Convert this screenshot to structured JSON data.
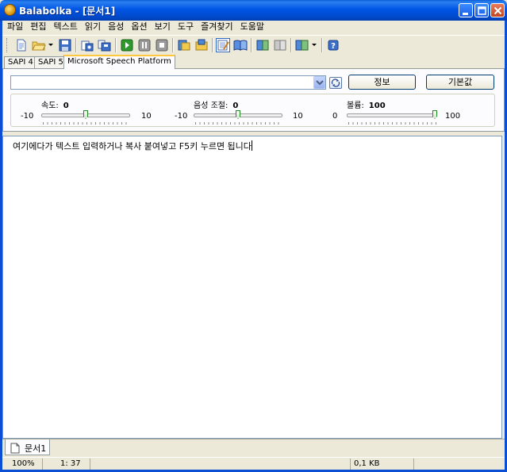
{
  "window": {
    "title": "Balabolka - [문서1]"
  },
  "menu": [
    "파일",
    "편집",
    "텍스트",
    "읽기",
    "음성",
    "옵션",
    "보기",
    "도구",
    "즐겨찾기",
    "도움말"
  ],
  "toolbar": {
    "icons": [
      "new-document-icon",
      "open-folder-icon",
      "save-icon",
      "export-audio-icon",
      "batch-convert-icon",
      "play-icon",
      "pause-icon",
      "stop-icon",
      "spell-check-icon",
      "dictionary-icon",
      "edit-mode-icon",
      "read-mode-icon",
      "voice-a-icon",
      "voice-b-icon",
      "voice-settings-icon",
      "help-icon"
    ]
  },
  "tabs": [
    "SAPI 4",
    "SAPI 5",
    "Microsoft Speech Platform"
  ],
  "voice": {
    "selected": "",
    "info_button": "정보",
    "default_button": "기본값"
  },
  "sliders": {
    "rate": {
      "label": "속도:",
      "value": "0",
      "min": "-10",
      "max": "10",
      "level": 0.5
    },
    "pitch": {
      "label": "음성 조절:",
      "value": "0",
      "min": "-10",
      "max": "10",
      "level": 0.5
    },
    "volume": {
      "label": "볼륨:",
      "value": "100",
      "min": "0",
      "max": "100",
      "level": 1.0
    }
  },
  "editor": {
    "text": "여기에다가 텍스트 입력하거나 복사 붙여넣고 F5키 누르면 됩니다"
  },
  "document_tab": "문서1",
  "status": {
    "zoom": "100%",
    "position": "1:  37",
    "size": "0,1 KB"
  },
  "colors": {
    "titlebar": "#0055e5",
    "active_tab_accent": "#ffc83c",
    "slider_thumb": "#1f8b1f"
  }
}
